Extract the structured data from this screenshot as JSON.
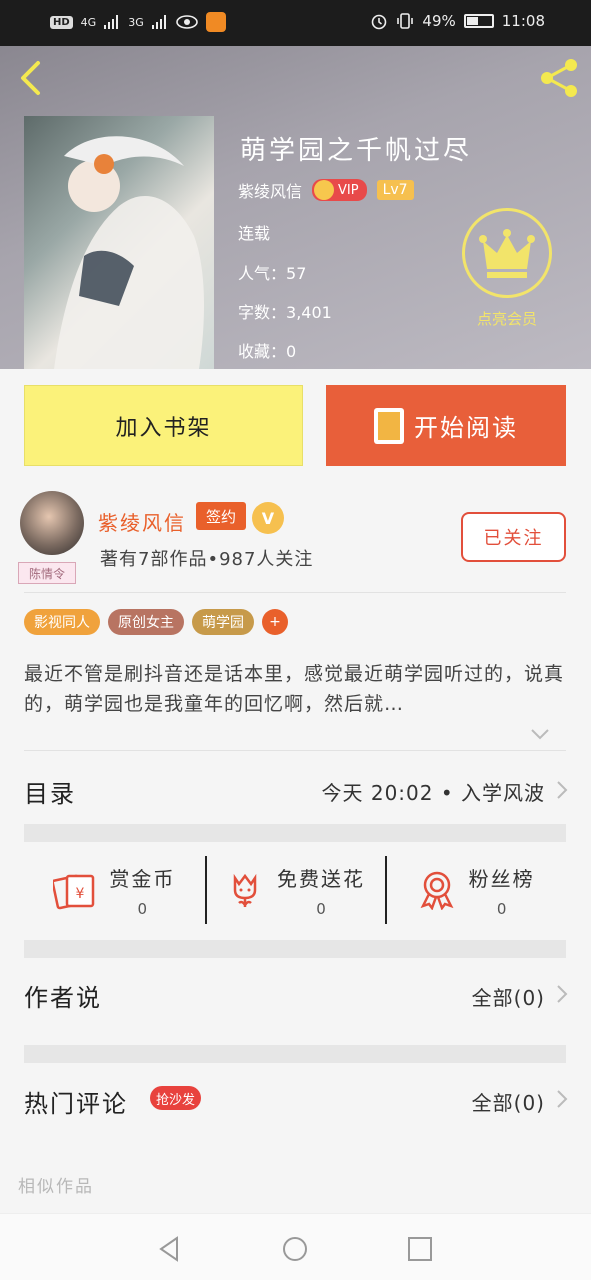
{
  "status_bar": {
    "left_icons": [
      "hd-icon",
      "signal-4g-icon",
      "signal-3g-icon",
      "eye-icon",
      "app-notification-icon"
    ],
    "hd": "HD",
    "net1": "4G",
    "net2": "3G",
    "battery_percent": "49%",
    "time": "11:08"
  },
  "book": {
    "title": "萌学园之千帆过尽",
    "author": "紫绫风信",
    "vip": "VIP",
    "level": "Lv7",
    "status": "连载",
    "popularity_label": "人气：",
    "popularity": "57",
    "words_label": "字数：",
    "words": "3,401",
    "favorites_label": "收藏：",
    "favorites": "0",
    "vip_cta": "点亮会员"
  },
  "buttons": {
    "add_shelf": "加入书架",
    "start_read": "开始阅读",
    "follow": "已关注"
  },
  "author_card": {
    "name": "紫绫风信",
    "sign_badge": "签约",
    "v_badge": "V",
    "avatar_tag": "陈情令",
    "stats": "著有7部作品•987人关注"
  },
  "tags": [
    {
      "label": "影视同人",
      "color": "#f0a23c"
    },
    {
      "label": "原创女主",
      "color": "#b87462"
    },
    {
      "label": "萌学园",
      "color": "#c79a4a"
    },
    {
      "label": "+",
      "color": "#e9602b"
    }
  ],
  "synopsis": "最近不管是刷抖音还是话本里，感觉最近萌学园听过的，说真的，萌学园也是我童年的回忆啊，然后就…",
  "catalog": {
    "label": "目录",
    "latest": "今天 20:02 • 入学风波"
  },
  "actions": [
    {
      "label": "赏金币",
      "count": "0",
      "icon": "red-envelope-icon"
    },
    {
      "label": "免费送花",
      "count": "0",
      "icon": "flower-icon"
    },
    {
      "label": "粉丝榜",
      "count": "0",
      "icon": "medal-icon"
    }
  ],
  "author_says": {
    "label": "作者说",
    "all": "全部(0)"
  },
  "hot_comments": {
    "label": "热门评论",
    "badge": "抢沙发",
    "all": "全部(0)"
  },
  "similar": "相似作品",
  "colors": {
    "accent_orange": "#e9602b",
    "shelf_yellow": "#fbf27a",
    "read_orange": "#e85f3a",
    "vip_yellow": "#f2e46a"
  }
}
